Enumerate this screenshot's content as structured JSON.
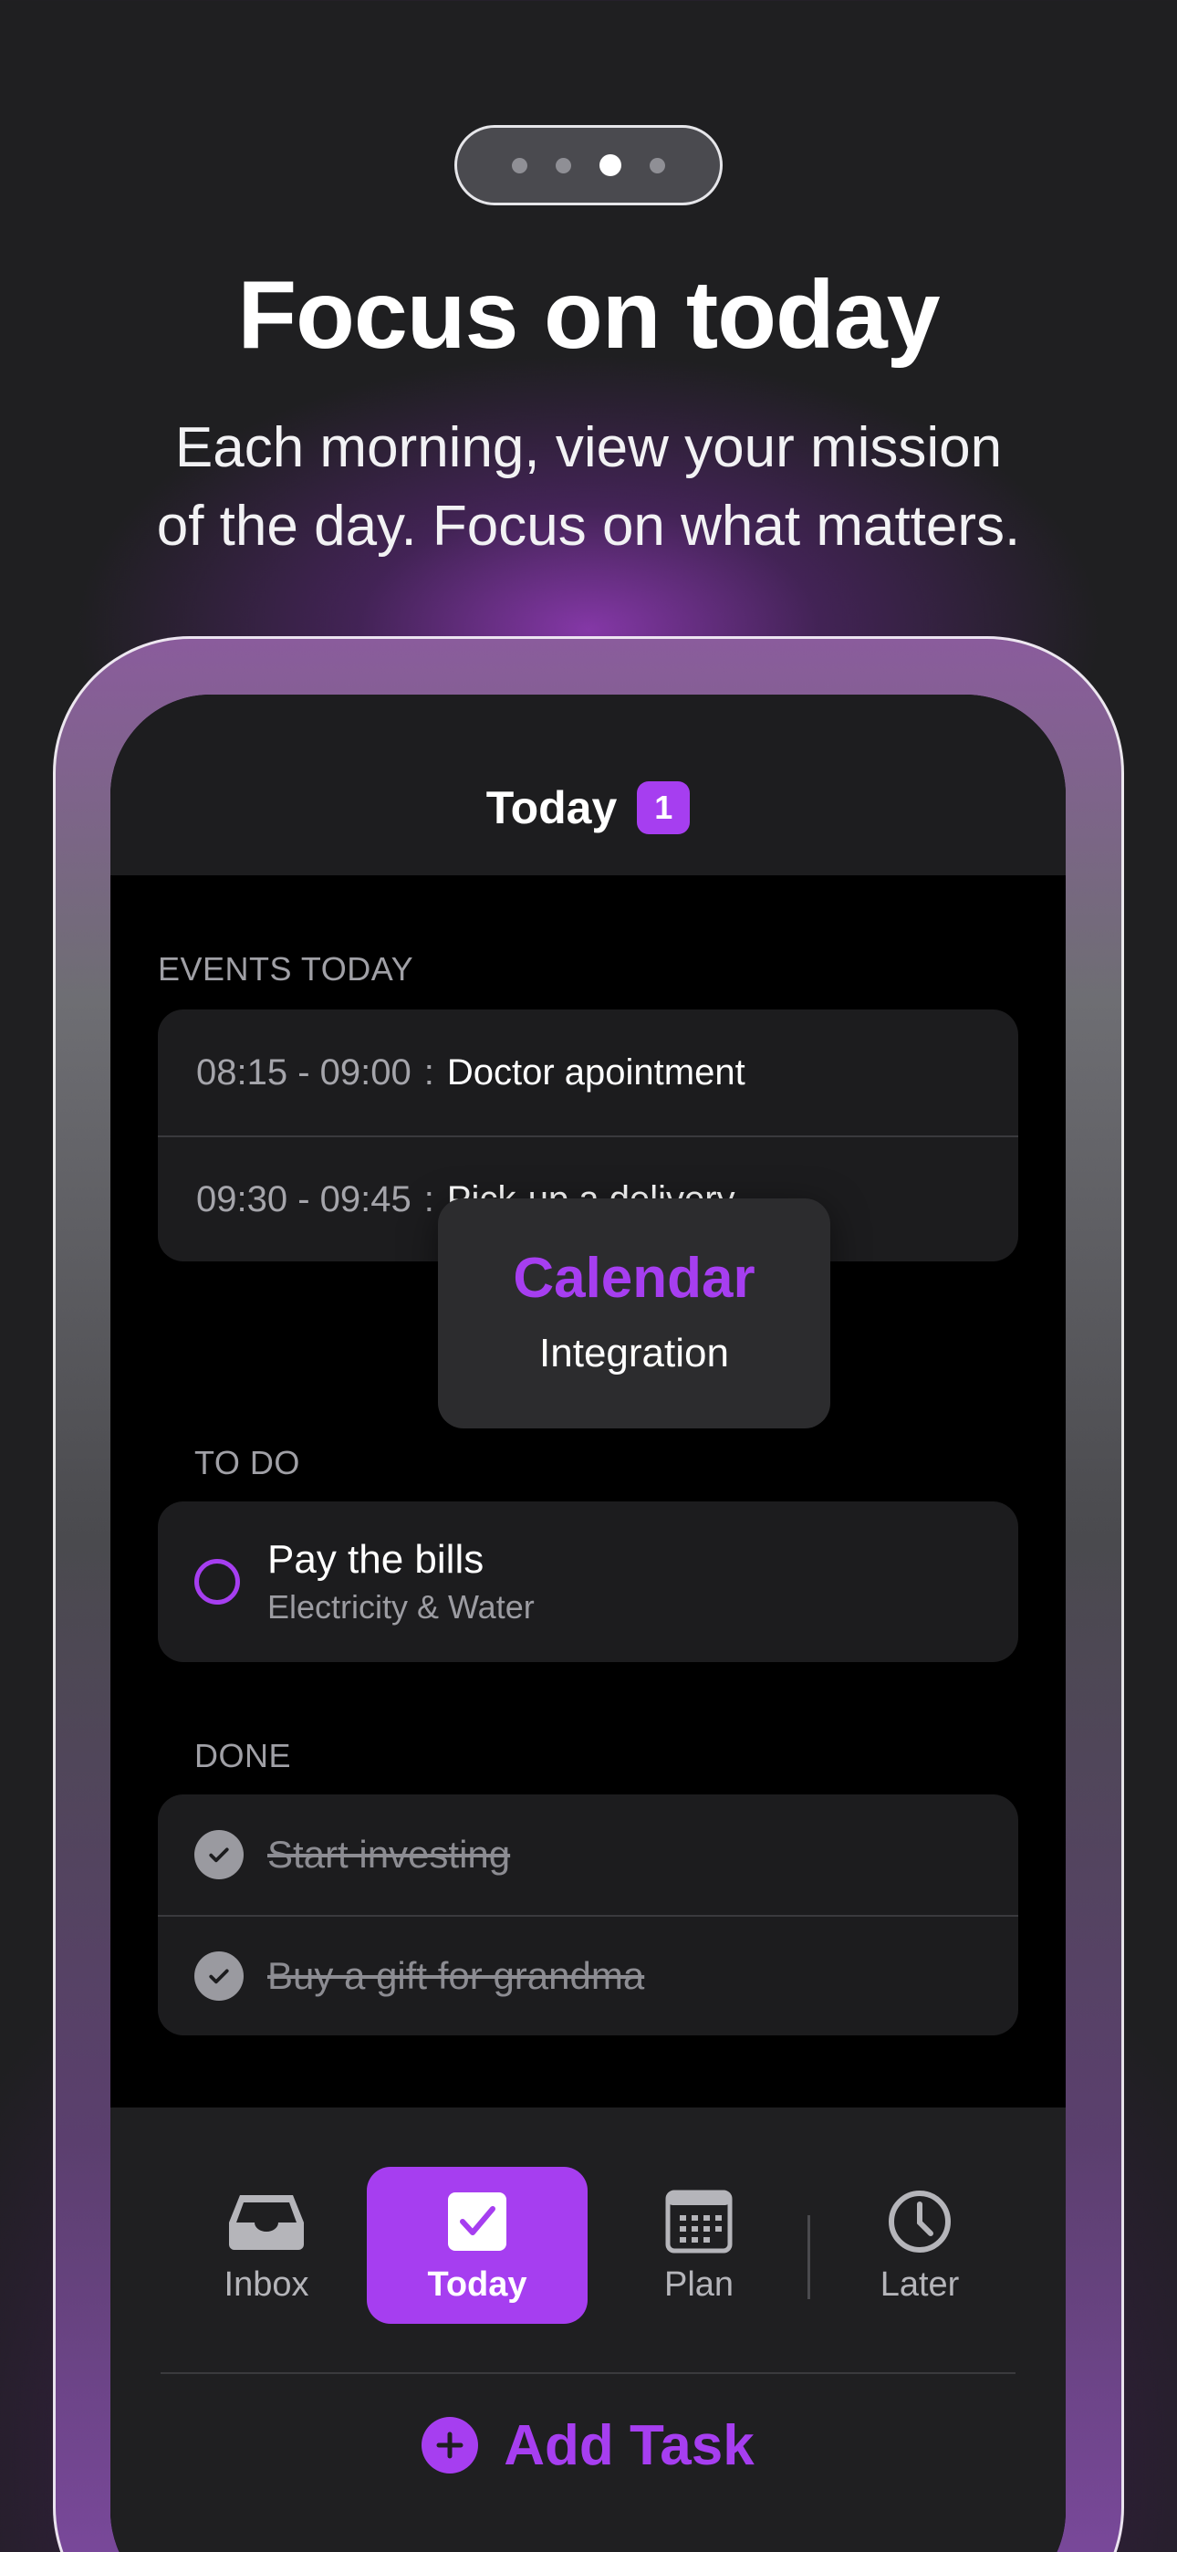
{
  "pager": {
    "count": 4,
    "active_index": 2
  },
  "headline": "Focus on today",
  "subline_1": "Each morning, view your mission",
  "subline_2": "of the day. Focus on what matters.",
  "nav": {
    "title": "Today",
    "badge": "1"
  },
  "events": {
    "section_label": "EVENTS TODAY",
    "items": [
      {
        "time": "08:15 - 09:00",
        "sep": ":",
        "title": "Doctor apointment"
      },
      {
        "time": "09:30 - 09:45",
        "sep": ":",
        "title": "Pick-up a delivery"
      }
    ]
  },
  "popup": {
    "title": "Calendar",
    "subtitle": "Integration"
  },
  "todo": {
    "section_label": "TO DO",
    "items": [
      {
        "title": "Pay the bills",
        "subtitle": "Electricity & Water"
      }
    ]
  },
  "done": {
    "section_label": "DONE",
    "items": [
      {
        "title": "Start investing"
      },
      {
        "title": "Buy a gift for grandma"
      }
    ]
  },
  "tabs": [
    {
      "label": "Inbox",
      "icon": "inbox-icon"
    },
    {
      "label": "Today",
      "icon": "checkbox-icon",
      "active": true
    },
    {
      "label": "Plan",
      "icon": "calendar-icon"
    },
    {
      "label": "Later",
      "icon": "clock-icon"
    }
  ],
  "add_task": {
    "label": "Add Task",
    "icon": "plus-circle-icon"
  },
  "colors": {
    "accent": "#a63ef0",
    "background": "#1f1f21",
    "card": "#1c1c1e"
  }
}
